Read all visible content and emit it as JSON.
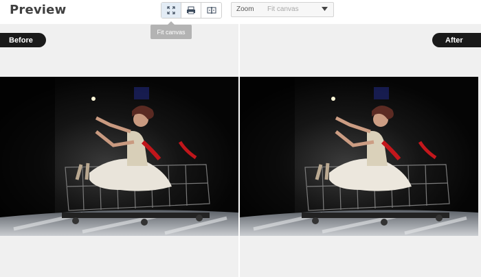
{
  "header": {
    "title": "Preview",
    "tools": [
      {
        "icon": "fit-canvas-icon",
        "active": true
      },
      {
        "icon": "print-preview-icon",
        "active": false
      },
      {
        "icon": "split-view-icon",
        "active": false
      }
    ],
    "zoom": {
      "label": "Zoom",
      "value": "Fit canvas"
    },
    "tooltip": "Fit canvas"
  },
  "panes": {
    "before_label": "Before",
    "after_label": "After"
  },
  "colors": {
    "badge": "#1a1a1a",
    "pane_bg": "#f0f0f0",
    "tooltip_bg": "#b3b3b3"
  }
}
